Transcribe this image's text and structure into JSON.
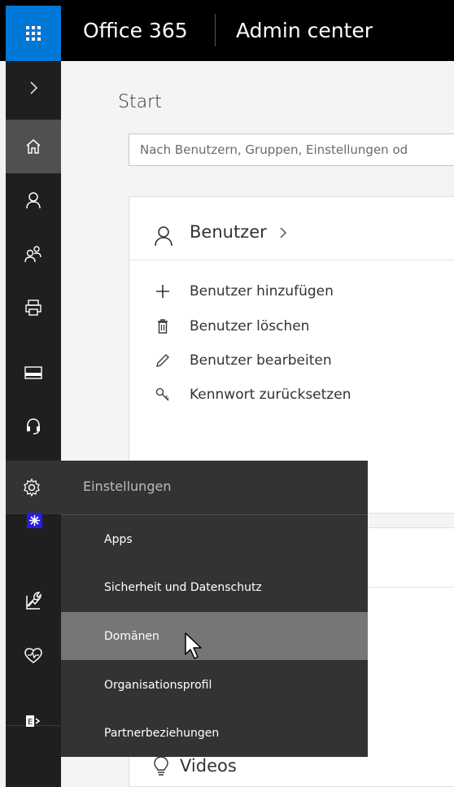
{
  "header": {
    "brand": "Office 365",
    "app_name": "Admin center",
    "launcher_icon": "app-launcher-icon"
  },
  "rail": {
    "items": [
      {
        "name": "expand",
        "icon": "chevron-right-icon",
        "active": false
      },
      {
        "name": "home",
        "icon": "home-icon",
        "active": true
      },
      {
        "name": "users",
        "icon": "user-icon",
        "active": false
      },
      {
        "name": "groups",
        "icon": "groups-icon",
        "active": false
      },
      {
        "name": "resources",
        "icon": "printer-icon",
        "active": false
      },
      {
        "name": "billing",
        "icon": "credit-card-icon",
        "active": false
      },
      {
        "name": "support",
        "icon": "headset-icon",
        "active": false
      },
      {
        "name": "settings",
        "icon": "gear-icon",
        "active": false
      },
      {
        "name": "setup",
        "icon": "wrench-icon",
        "active": false
      },
      {
        "name": "reports",
        "icon": "chart-icon",
        "active": false
      },
      {
        "name": "health",
        "icon": "heart-pulse-icon",
        "active": false
      },
      {
        "name": "exchange",
        "icon": "exchange-icon",
        "active": false
      }
    ]
  },
  "main": {
    "title": "Start",
    "search_placeholder": "Nach Benutzern, Gruppen, Einstellungen od",
    "users_card": {
      "title": "Benutzer",
      "actions": [
        {
          "label": "Benutzer hinzufügen",
          "icon": "plus-icon"
        },
        {
          "label": "Benutzer löschen",
          "icon": "trash-icon"
        },
        {
          "label": "Benutzer bearbeiten",
          "icon": "pencil-icon"
        },
        {
          "label": "Kennwort zurücksetzen",
          "icon": "key-icon"
        }
      ]
    },
    "videos_label": "Videos"
  },
  "flyout": {
    "title": "Einstellungen",
    "items": [
      {
        "label": "Apps",
        "hover": false
      },
      {
        "label": "Sicherheit und Datenschutz",
        "hover": false
      },
      {
        "label": "Domänen",
        "hover": true
      },
      {
        "label": "Organisationsprofil",
        "hover": false
      },
      {
        "label": "Partnerbeziehungen",
        "hover": false
      }
    ]
  },
  "colors": {
    "accent": "#0078d7",
    "header_bg": "#000000",
    "rail_bg": "#1f1f1f",
    "rail_active": "#505050",
    "flyout_bg": "#333333",
    "flyout_hover": "#767676"
  }
}
